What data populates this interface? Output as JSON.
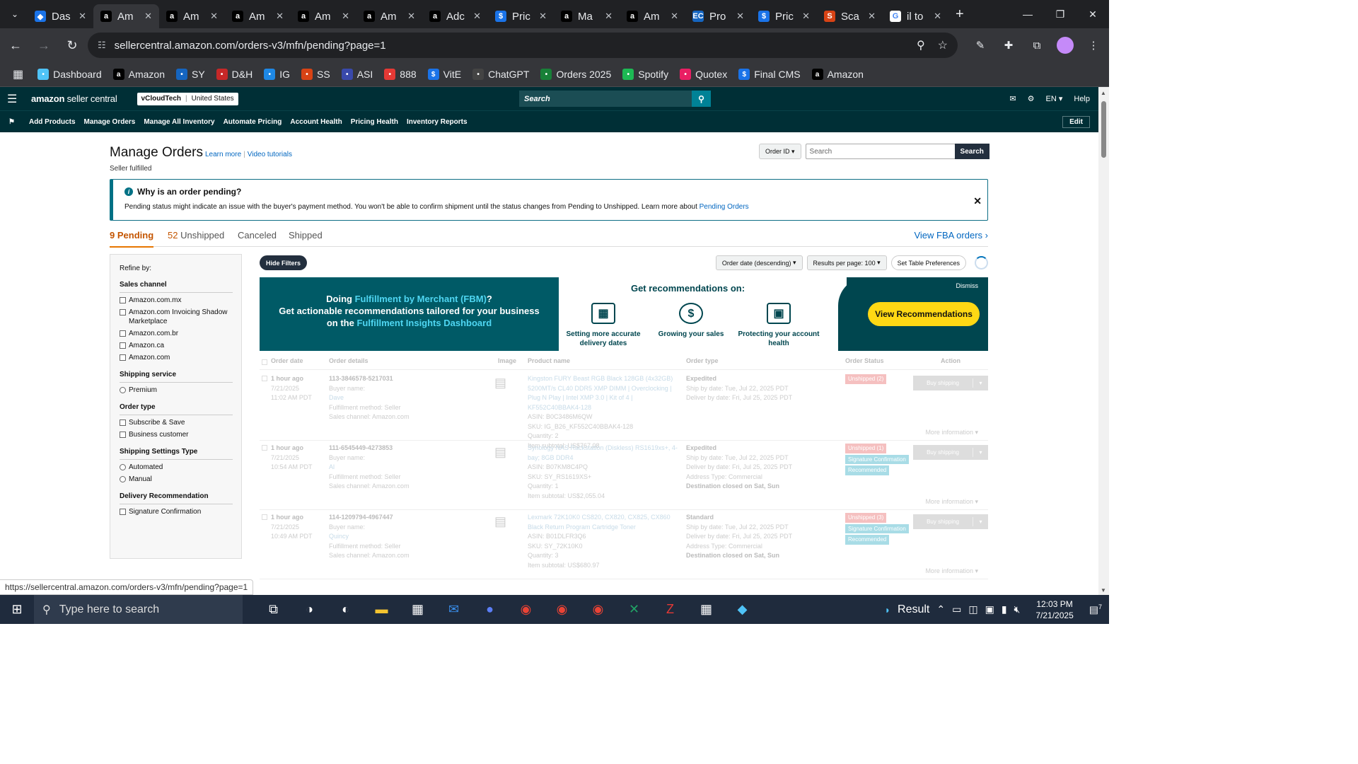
{
  "browser": {
    "tabs": [
      {
        "title": "Das",
        "favicon": "globe-icon",
        "color": "#1a73e8",
        "active": false
      },
      {
        "title": "Am",
        "favicon": "amazon-icon",
        "color": "#000000",
        "active": true
      },
      {
        "title": "Am",
        "favicon": "amazon-icon",
        "color": "#000000",
        "active": false
      },
      {
        "title": "Am",
        "favicon": "amazon-icon",
        "color": "#000000",
        "active": false
      },
      {
        "title": "Am",
        "favicon": "amazon-icon",
        "color": "#000000",
        "active": false
      },
      {
        "title": "Am",
        "favicon": "amazon-icon",
        "color": "#000000",
        "active": false
      },
      {
        "title": "Adc",
        "favicon": "amazon-icon",
        "color": "#000000",
        "active": false
      },
      {
        "title": "Pric",
        "favicon": "dollar-icon",
        "color": "#1a73e8",
        "active": false
      },
      {
        "title": "Ma",
        "favicon": "amazon-icon",
        "color": "#000000",
        "active": false
      },
      {
        "title": "Am",
        "favicon": "amazon-icon",
        "color": "#000000",
        "active": false
      },
      {
        "title": "Pro",
        "favicon": "ec-icon",
        "color": "#1565c0",
        "active": false
      },
      {
        "title": "Pric",
        "favicon": "dollar-icon",
        "color": "#1a73e8",
        "active": false
      },
      {
        "title": "Sca",
        "favicon": "ss-icon",
        "color": "#d84315",
        "active": false
      },
      {
        "title": "il to",
        "favicon": "google-icon",
        "color": "#ffffff",
        "active": false
      }
    ],
    "url": "sellercentral.amazon.com/orders-v3/mfn/pending?page=1",
    "bookmarks": [
      {
        "label": "Dashboard",
        "icon": "diamond-icon",
        "color": "#4fc3f7"
      },
      {
        "label": "Amazon",
        "icon": "amazon-icon",
        "color": "#000000"
      },
      {
        "label": "SY",
        "icon": "ec-icon",
        "color": "#1565c0"
      },
      {
        "label": "D&H",
        "icon": "dh-icon",
        "color": "#c62828"
      },
      {
        "label": "IG",
        "icon": "ig-icon",
        "color": "#1e88e5"
      },
      {
        "label": "SS",
        "icon": "ss-icon",
        "color": "#d84315"
      },
      {
        "label": "ASI",
        "icon": "asi-icon",
        "color": "#3949ab"
      },
      {
        "label": "888",
        "icon": "888-icon",
        "color": "#e53935"
      },
      {
        "label": "VitE",
        "icon": "dollar-icon",
        "color": "#1a73e8"
      },
      {
        "label": "ChatGPT",
        "icon": "chatgpt-icon",
        "color": "#444444"
      },
      {
        "label": "Orders 2025",
        "icon": "sheets-icon",
        "color": "#188038"
      },
      {
        "label": "Spotify",
        "icon": "spotify-icon",
        "color": "#1db954"
      },
      {
        "label": "Quotex",
        "icon": "quotex-icon",
        "color": "#e91e63"
      },
      {
        "label": "Final CMS",
        "icon": "dollar-icon",
        "color": "#1a73e8"
      },
      {
        "label": "Amazon",
        "icon": "amazon-icon",
        "color": "#000000"
      }
    ],
    "status_url": "https://sellercentral.amazon.com/orders-v3/mfn/pending?page=1"
  },
  "header": {
    "logo_main": "amazon",
    "logo_sub": "seller central",
    "store": "vCloudTech",
    "marketplace": "United States",
    "search_placeholder": "Search",
    "language": "EN",
    "help": "Help"
  },
  "nav": {
    "items": [
      "Add Products",
      "Manage Orders",
      "Manage All Inventory",
      "Automate Pricing",
      "Account Health",
      "Pricing Health",
      "Inventory Reports"
    ],
    "edit": "Edit"
  },
  "page": {
    "title": "Manage Orders",
    "learn_more": "Learn more",
    "video_tutorials": "Video tutorials",
    "subtitle": "Seller fulfilled",
    "search_by": "Order ID",
    "search_placeholder": "Search",
    "search_button": "Search"
  },
  "alert": {
    "title": "Why is an order pending?",
    "text": "Pending status might indicate an issue with the buyer's payment method. You won't be able to confirm shipment until the status changes from Pending to Unshipped. Learn more about",
    "link": "Pending Orders"
  },
  "order_tabs": [
    {
      "count": "9",
      "label": "Pending"
    },
    {
      "count": "52",
      "label": "Unshipped"
    },
    {
      "count": "",
      "label": "Canceled"
    },
    {
      "count": "",
      "label": "Shipped"
    }
  ],
  "view_fba": "View FBA orders",
  "filters": {
    "title": "Refine by:",
    "groups": [
      {
        "title": "Sales channel",
        "type": "checkbox",
        "options": [
          "Amazon.com.mx",
          "Amazon.com Invoicing Shadow Marketplace",
          "Amazon.com.br",
          "Amazon.ca",
          "Amazon.com"
        ]
      },
      {
        "title": "Shipping service",
        "type": "radio",
        "options": [
          "Premium"
        ]
      },
      {
        "title": "Order type",
        "type": "checkbox",
        "options": [
          "Subscribe & Save",
          "Business customer"
        ]
      },
      {
        "title": "Shipping Settings Type",
        "type": "radio",
        "options": [
          "Automated",
          "Manual"
        ]
      },
      {
        "title": "Delivery Recommendation",
        "type": "checkbox",
        "options": [
          "Signature Confirmation"
        ]
      }
    ]
  },
  "controls": {
    "hide_filters": "Hide Filters",
    "sort": "Order date (descending)",
    "per_page": "Results per page: 100",
    "table_prefs": "Set Table Preferences"
  },
  "banner": {
    "line1_pre": "Doing ",
    "line1_hl": "Fulfillment by Merchant (FBM)",
    "line1_post": "?",
    "line2": "Get actionable recommendations tailored for your business",
    "line3_pre": "on the ",
    "line3_hl": "Fulfillment Insights Dashboard",
    "rec_title": "Get recommendations on:",
    "recs": [
      "Setting more accurate delivery dates",
      "Growing your sales",
      "Protecting your account health"
    ],
    "dismiss": "Dismiss",
    "cta": "View Recommendations"
  },
  "table": {
    "headers": [
      "Order date",
      "Order details",
      "Image",
      "Product name",
      "Order type",
      "Order Status",
      "Action"
    ],
    "rows": [
      {
        "age": "1 hour ago",
        "date": "7/21/2025",
        "time": "11:02 AM PDT",
        "order_id": "113-3846578-5217031",
        "buyer_label": "Buyer name:",
        "buyer": "Dave",
        "fulfillment": "Fulfillment method: Seller",
        "channel": "Sales channel: Amazon.com",
        "product": "Kingston FURY Beast RGB Black 128GB (4x32GB) 5200MT/s CL40 DDR5 XMP DIMM | Overclocking | Plug N Play | Intel XMP 3.0 | Kit of 4 | KF552C40BBAK4-128",
        "asin": "ASIN: B0C3486M6QW",
        "sku": "SKU: IG_B26_KF552C40BBAK4-128",
        "qty": "Quantity: 2",
        "subtotal": "Item subtotal: US$767.08",
        "order_type": "Expedited",
        "ship_by": "Ship by date: Tue, Jul 22, 2025 PDT",
        "deliver_by": "Deliver by date: Fri, Jul 25, 2025 PDT",
        "address": "",
        "destination": "",
        "status": [
          "Unshipped (2)"
        ],
        "action": "Buy shipping",
        "more": "More information"
      },
      {
        "age": "1 hour ago",
        "date": "7/21/2025",
        "time": "10:54 AM PDT",
        "order_id": "111-6545449-4273853",
        "buyer_label": "Buyer name:",
        "buyer": "Al",
        "fulfillment": "Fulfillment method: Seller",
        "channel": "Sales channel: Amazon.com",
        "product": "Synology NAS Rackstation (Diskless) RS1619xs+, 4-bay; 8GB DDR4",
        "asin": "ASIN: B07KM8C4PQ",
        "sku": "SKU: SY_RS1619XS+",
        "qty": "Quantity: 1",
        "subtotal": "Item subtotal: US$2,055.04",
        "order_type": "Expedited",
        "ship_by": "Ship by date: Tue, Jul 22, 2025 PDT",
        "deliver_by": "Deliver by date: Fri, Jul 25, 2025 PDT",
        "address": "Address Type: Commercial",
        "destination": "Destination closed on Sat, Sun",
        "status": [
          "Unshipped (1)",
          "Signature Confirmation",
          "Recommended"
        ],
        "action": "Buy shipping",
        "more": "More information"
      },
      {
        "age": "1 hour ago",
        "date": "7/21/2025",
        "time": "10:49 AM PDT",
        "order_id": "114-1209794-4967447",
        "buyer_label": "Buyer name:",
        "buyer": "Quincy",
        "fulfillment": "Fulfillment method: Seller",
        "channel": "Sales channel: Amazon.com",
        "product": "Lexmark 72K10K0 CS820, CX820, CX825, CX860 Black Return Program Cartridge Toner",
        "asin": "ASIN: B01DLFR3Q6",
        "sku": "SKU: SY_72K10K0",
        "qty": "Quantity: 3",
        "subtotal": "Item subtotal: US$680.97",
        "order_type": "Standard",
        "ship_by": "Ship by date: Tue, Jul 22, 2025 PDT",
        "deliver_by": "Deliver by date: Fri, Jul 25, 2025 PDT",
        "address": "Address Type: Commercial",
        "destination": "Destination closed on Sat, Sun",
        "status": [
          "Unshipped (3)",
          "Signature Confirmation",
          "Recommended"
        ],
        "action": "Buy shipping",
        "more": "More information"
      }
    ]
  },
  "taskbar": {
    "search_placeholder": "Type here to search",
    "result": "Result",
    "time": "12:03 PM",
    "date": "7/21/2025",
    "notifications": "7"
  },
  "colors": {
    "header_bg": "#002f36",
    "accent_orange": "#c45500",
    "link_blue": "#0066c0",
    "cta_yellow": "#ffd814"
  }
}
